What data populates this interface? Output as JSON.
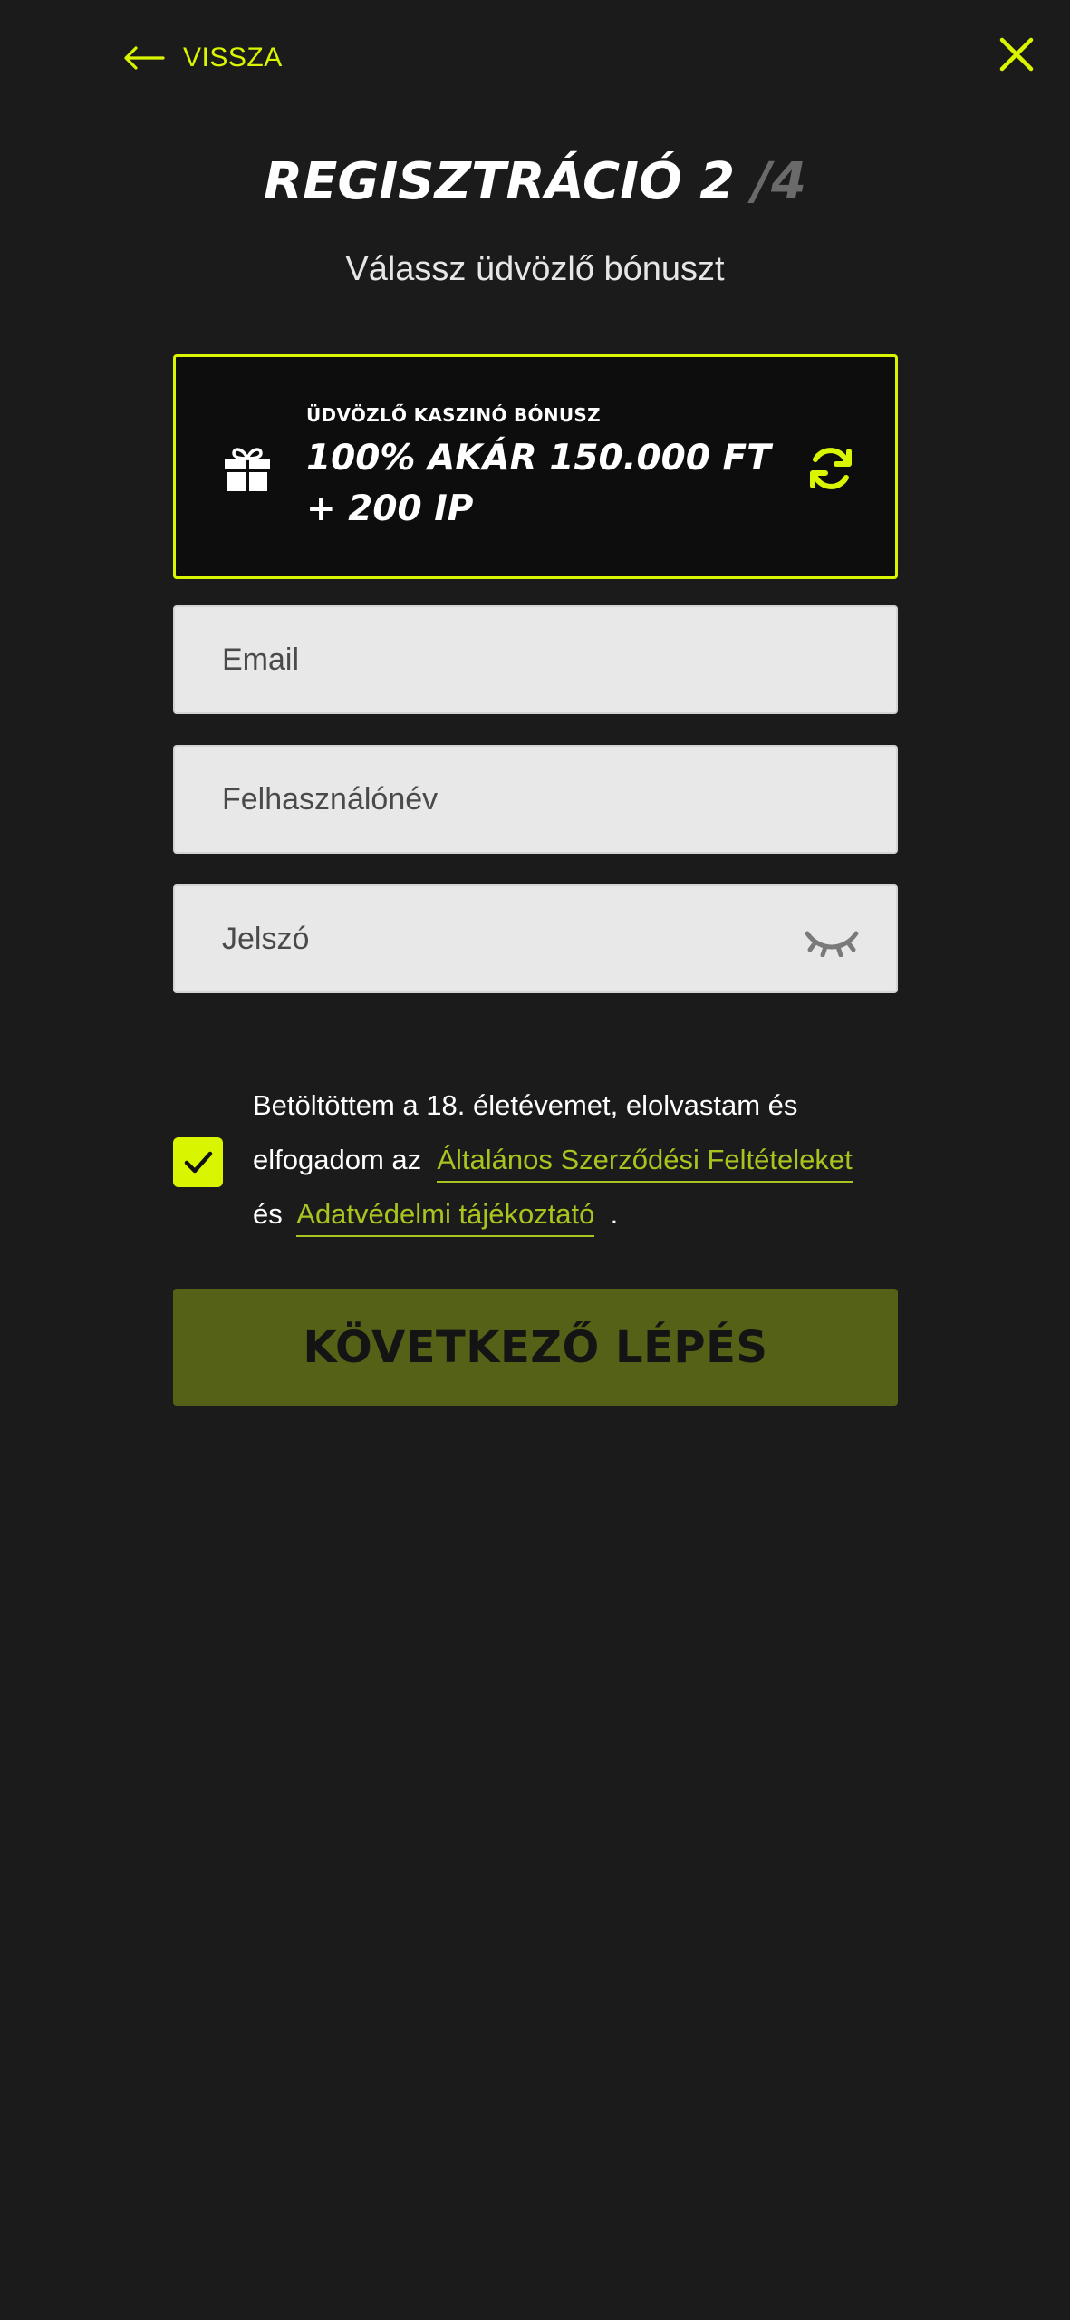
{
  "nav": {
    "back_label": "VISSZA"
  },
  "header": {
    "title": "REGISZTRÁCIÓ 2",
    "step_total": "/4",
    "subtitle": "Válassz üdvözlő bónuszt"
  },
  "bonus": {
    "label": "ÜDVÖZLŐ KASZINÓ BÓNUSZ",
    "title": "100% AKÁR 150.000 FT + 200 IP"
  },
  "form": {
    "email": {
      "placeholder": "Email",
      "value": ""
    },
    "username": {
      "placeholder": "Felhasználónév",
      "value": ""
    },
    "password": {
      "placeholder": "Jelszó",
      "value": ""
    }
  },
  "terms": {
    "checked": true,
    "text_1": "Betöltöttem a 18. életévemet, elolvastam és",
    "text_2": "elfogadom az",
    "link_1": "Általános Szerződési Feltételeket",
    "text_3": "és",
    "link_2": "Adatvédelmi tájékoztató",
    "text_4": "."
  },
  "next_button": {
    "label": "KÖVETKEZŐ LÉPÉS"
  },
  "colors": {
    "accent": "#d9f500",
    "background": "#1b1b1b",
    "button": "#546116",
    "link": "#a9c41f"
  },
  "icons": [
    "arrow-left-icon",
    "close-icon",
    "gift-icon",
    "refresh-icon",
    "eye-closed-icon",
    "checkmark-icon"
  ]
}
